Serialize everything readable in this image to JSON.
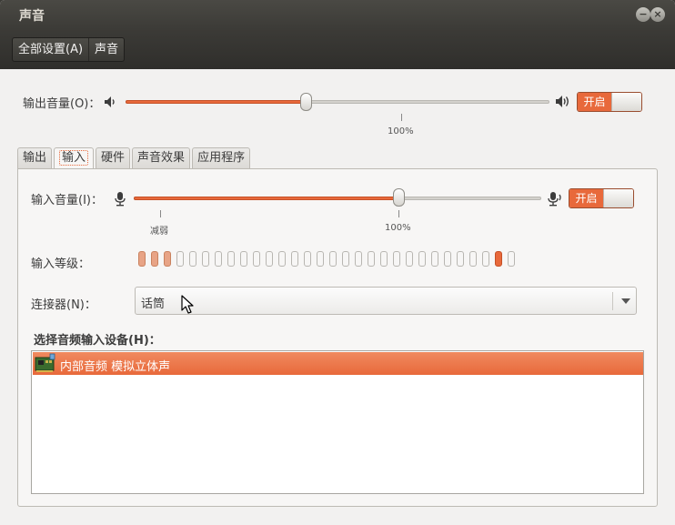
{
  "window": {
    "title": "声音",
    "minimize_glyph": "−",
    "close_glyph": "×"
  },
  "breadcrumb": {
    "all_settings": "全部设置(A)",
    "current": "声音"
  },
  "output": {
    "volume_label": "输出音量(O)：",
    "volume_percent": 64,
    "scale_100_label": "100%",
    "switch_label": "开启",
    "switch_on": true
  },
  "tabs": [
    {
      "label": "输出",
      "active": false
    },
    {
      "label": "输入",
      "active": true
    },
    {
      "label": "硬件",
      "active": false
    },
    {
      "label": "声音效果",
      "active": false
    },
    {
      "label": "应用程序",
      "active": false
    }
  ],
  "input": {
    "volume_label": "输入音量(I)：",
    "volume_percent": 100,
    "min_mark_label": "减弱",
    "scale_100_label": "100%",
    "switch_label": "开启",
    "switch_on": true,
    "level_label": "输入等级：",
    "level_segments_total": 30,
    "level_segments_lit": 3,
    "level_peak_segment": 28,
    "connector_label": "连接器(N)：",
    "connector_value": "话筒",
    "device_list_label": "选择音频输入设备(H)：",
    "devices": [
      {
        "name": "内部音频 模拟立体声",
        "icon": "sound-card-icon",
        "selected": true
      }
    ]
  },
  "colors": {
    "accent": "#e8693b",
    "titlebar": "#3c3b37",
    "window_bg": "#f2f1f0"
  }
}
